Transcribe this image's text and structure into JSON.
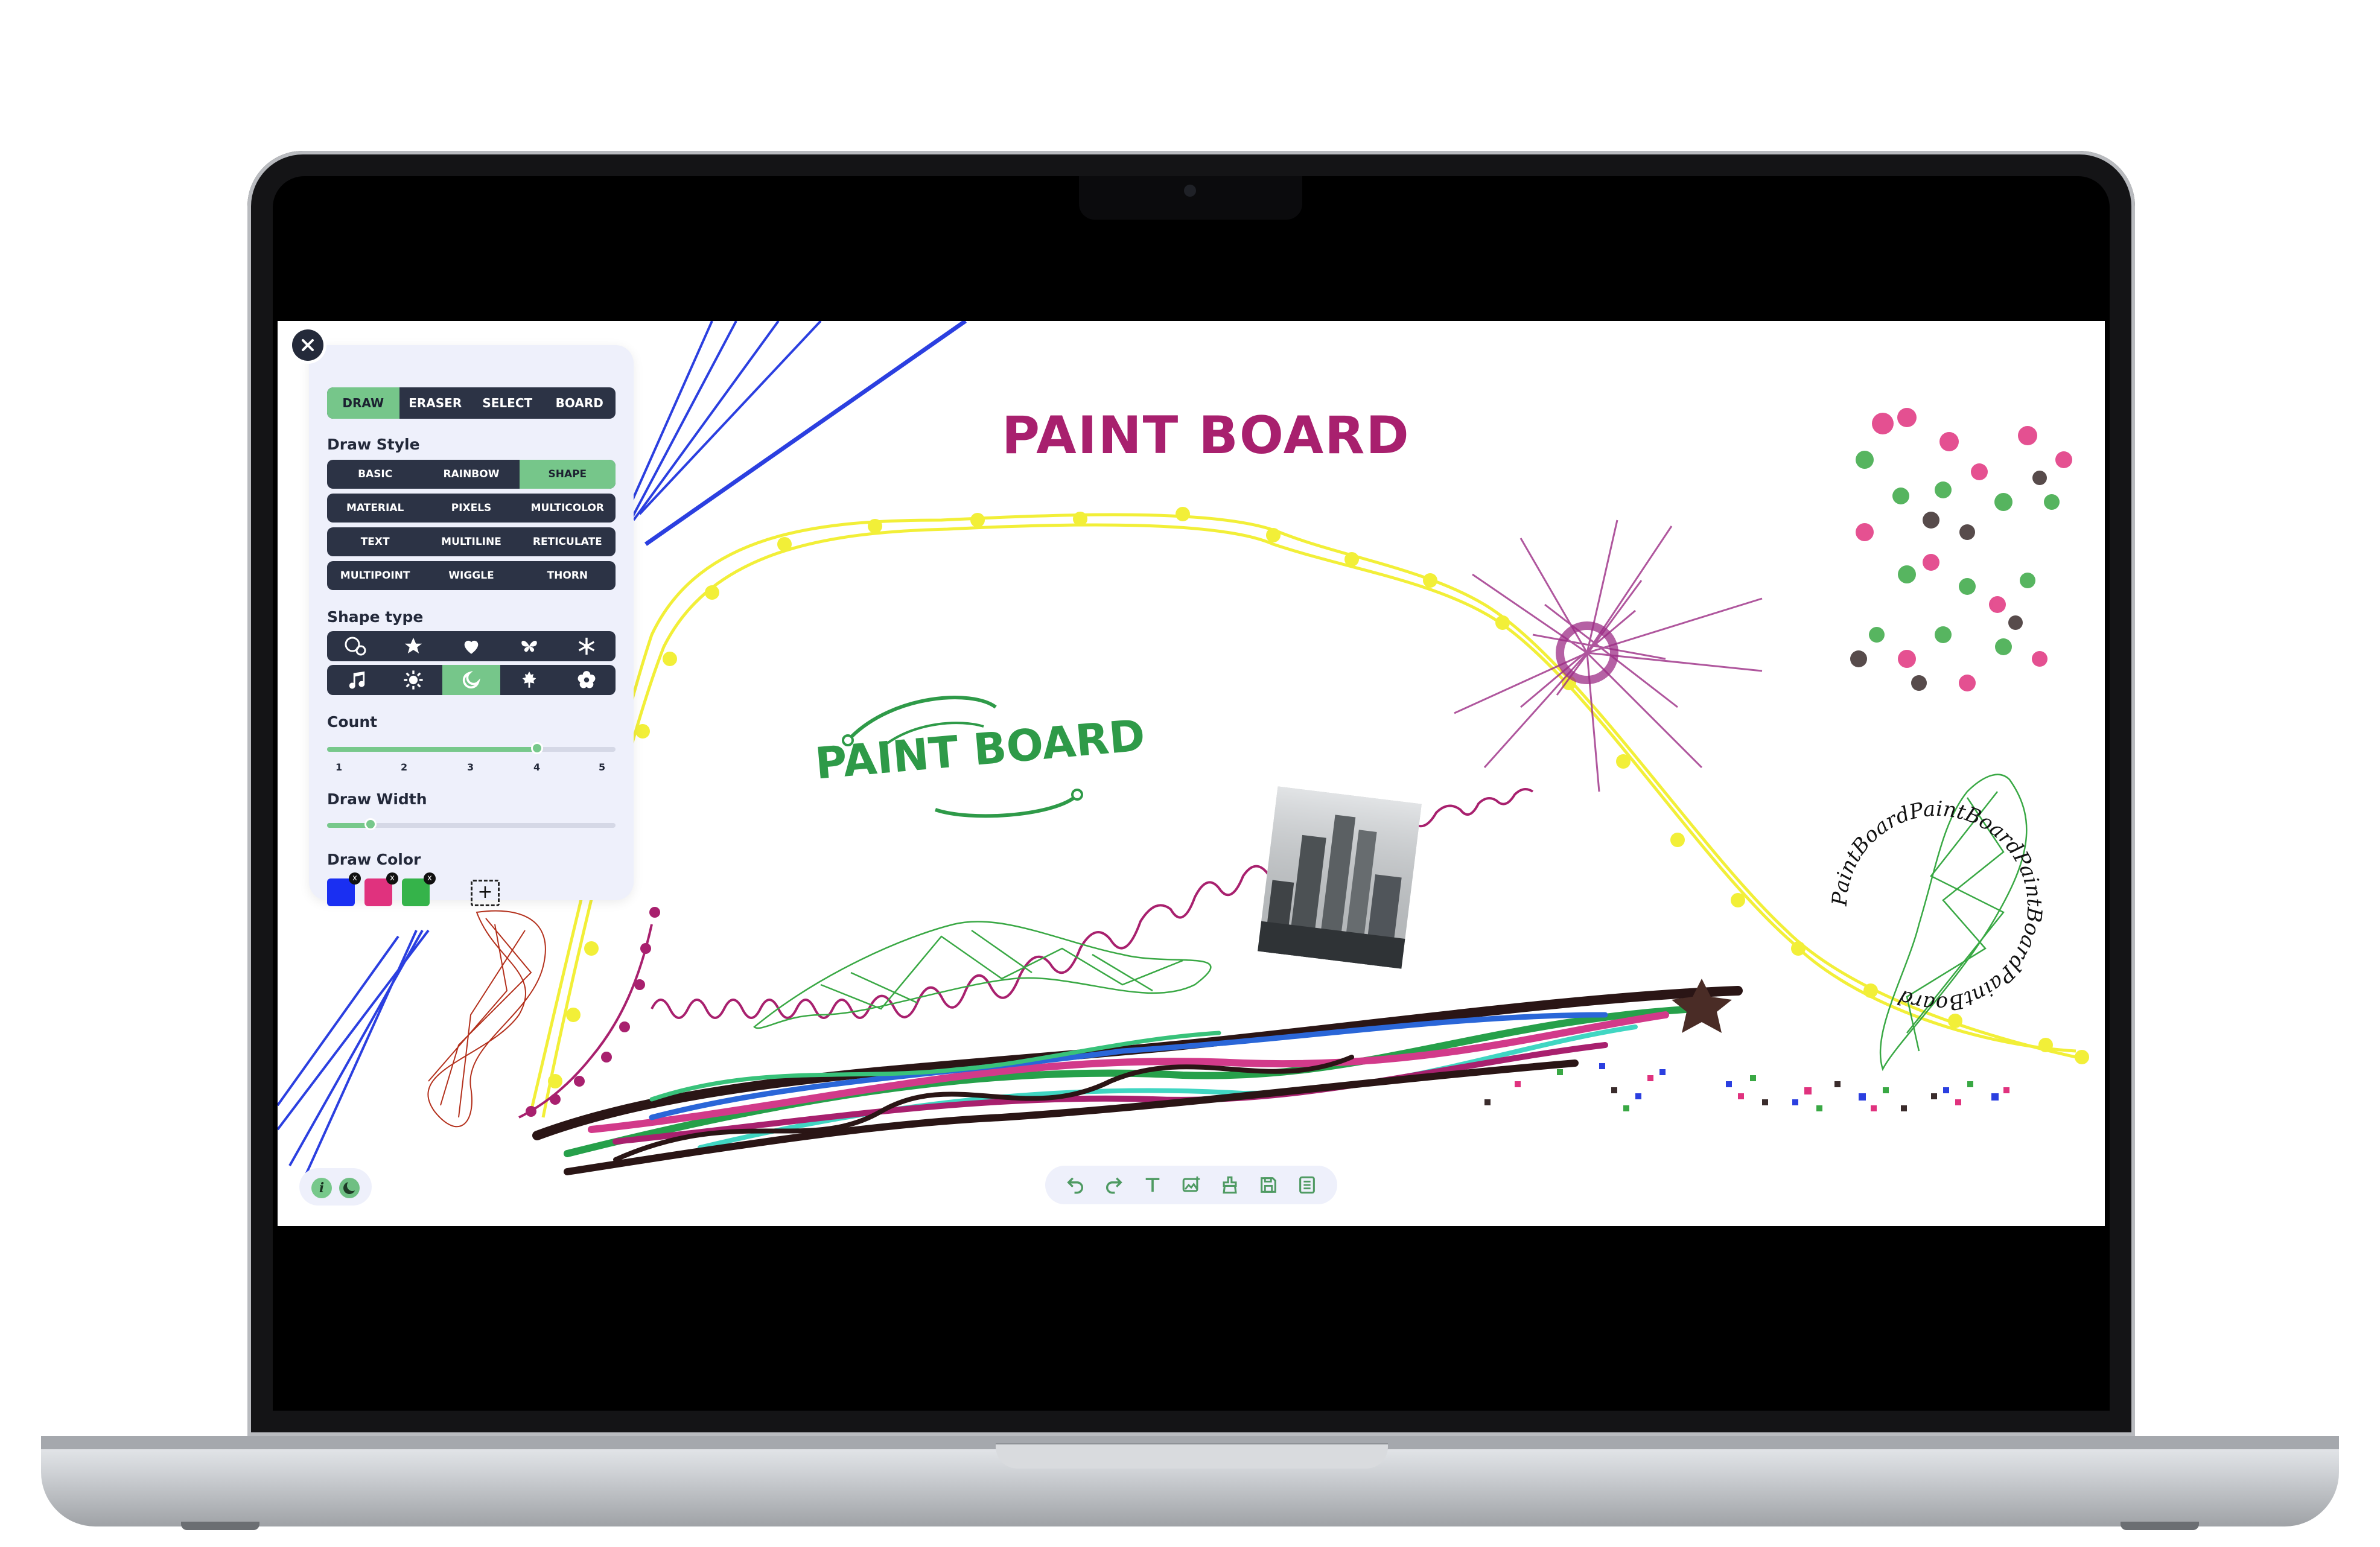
{
  "panel": {
    "tabs": [
      {
        "label": "DRAW",
        "active": true
      },
      {
        "label": "ERASER",
        "active": false
      },
      {
        "label": "SELECT",
        "active": false
      },
      {
        "label": "BOARD",
        "active": false
      }
    ],
    "draw_style_label": "Draw Style",
    "draw_styles": [
      [
        "BASIC",
        "RAINBOW",
        "SHAPE"
      ],
      [
        "MATERIAL",
        "PIXELS",
        "MULTICOLOR"
      ],
      [
        "TEXT",
        "MULTILINE",
        "RETICULATE"
      ],
      [
        "MULTIPOINT",
        "WIGGLE",
        "THORN"
      ]
    ],
    "active_style": "SHAPE",
    "shape_type_label": "Shape type",
    "shape_types": [
      [
        "bubbles-icon",
        "star-icon",
        "heart-icon",
        "butterfly-icon",
        "snowflake-icon"
      ],
      [
        "music-note-icon",
        "sun-icon",
        "moon-icon",
        "maple-leaf-icon",
        "flower-icon"
      ]
    ],
    "active_shape": "moon-icon",
    "count_label": "Count",
    "count_ticks": [
      "1",
      "2",
      "3",
      "4",
      "5"
    ],
    "count_value": 4,
    "draw_width_label": "Draw Width",
    "draw_width_fraction": 0.15,
    "draw_color_label": "Draw Color",
    "colors": [
      "#1a2ff2",
      "#e0327e",
      "#35b34a"
    ],
    "remove_color_label": "x",
    "add_color_label": "+"
  },
  "canvas": {
    "title_text": "PAINT BOARD",
    "title_color": "#a8206e",
    "logo_text": "PAINT BOARD",
    "logo_color": "#2e9a48",
    "circle_text": "PaintBoardPaintBoardPaintBoardPaintBoard"
  },
  "toolbar": {
    "tools": [
      "undo-icon",
      "redo-icon",
      "text-icon",
      "image-icon",
      "clear-icon",
      "save-icon",
      "file-list-icon"
    ]
  },
  "corner": {
    "info_label": "i"
  }
}
